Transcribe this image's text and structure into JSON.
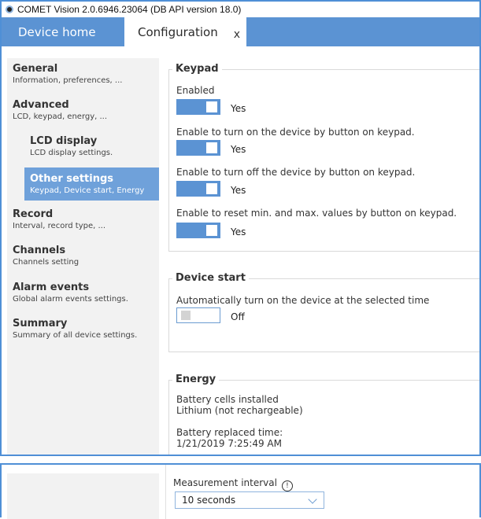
{
  "window": {
    "title": "COMET Vision 2.0.6946.23064 (DB API version 18.0)",
    "tabs": {
      "home": "Device home",
      "config": "Configuration",
      "close": "x"
    }
  },
  "sidebar": {
    "items": [
      {
        "title": "General",
        "subtitle": "Information, preferences, ..."
      },
      {
        "title": "Advanced",
        "subtitle": "LCD, keypad, energy, ..."
      },
      {
        "title": "LCD display",
        "subtitle": "LCD display settings."
      },
      {
        "title": "Other settings",
        "subtitle": "Keypad, Device start, Energy"
      },
      {
        "title": "Record",
        "subtitle": "Interval, record type, ..."
      },
      {
        "title": "Channels",
        "subtitle": "Channels setting"
      },
      {
        "title": "Alarm events",
        "subtitle": "Global alarm events settings."
      },
      {
        "title": "Summary",
        "subtitle": "Summary of all device settings."
      }
    ]
  },
  "keypad": {
    "title": "Keypad",
    "enabled_label": "Enabled",
    "enabled_value": "Yes",
    "turn_on_label": "Enable to turn on the device by button on keypad.",
    "turn_on_value": "Yes",
    "turn_off_label": "Enable to turn off the device by button on keypad.",
    "turn_off_value": "Yes",
    "reset_label": "Enable to reset min. and max. values by button on keypad.",
    "reset_value": "Yes"
  },
  "device_start": {
    "title": "Device start",
    "auto_label": "Automatically turn on the device at the selected time",
    "auto_value": "Off"
  },
  "energy": {
    "title": "Energy",
    "battery_label": "Battery cells installed",
    "battery_value": "Lithium (not rechargeable)",
    "replaced_label": "Battery replaced time:",
    "replaced_value": "1/21/2019 7:25:49 AM"
  },
  "measurement": {
    "label": "Measurement interval",
    "info_glyph": "!",
    "value": "10 seconds"
  },
  "colors": {
    "accent": "#5b93d3",
    "sidebar_bg": "#f2f2f2",
    "active_item": "#6fa1da",
    "toggle_off_bg": "#ffffff",
    "frame": "#4f8fd6"
  },
  "icons": {
    "app": "comet-app-icon",
    "info": "info-circle-icon",
    "dropdown": "chevron-down-icon"
  },
  "toggles": {
    "enabled": true,
    "turn_on": true,
    "turn_off": true,
    "reset": true,
    "auto_start": false
  }
}
